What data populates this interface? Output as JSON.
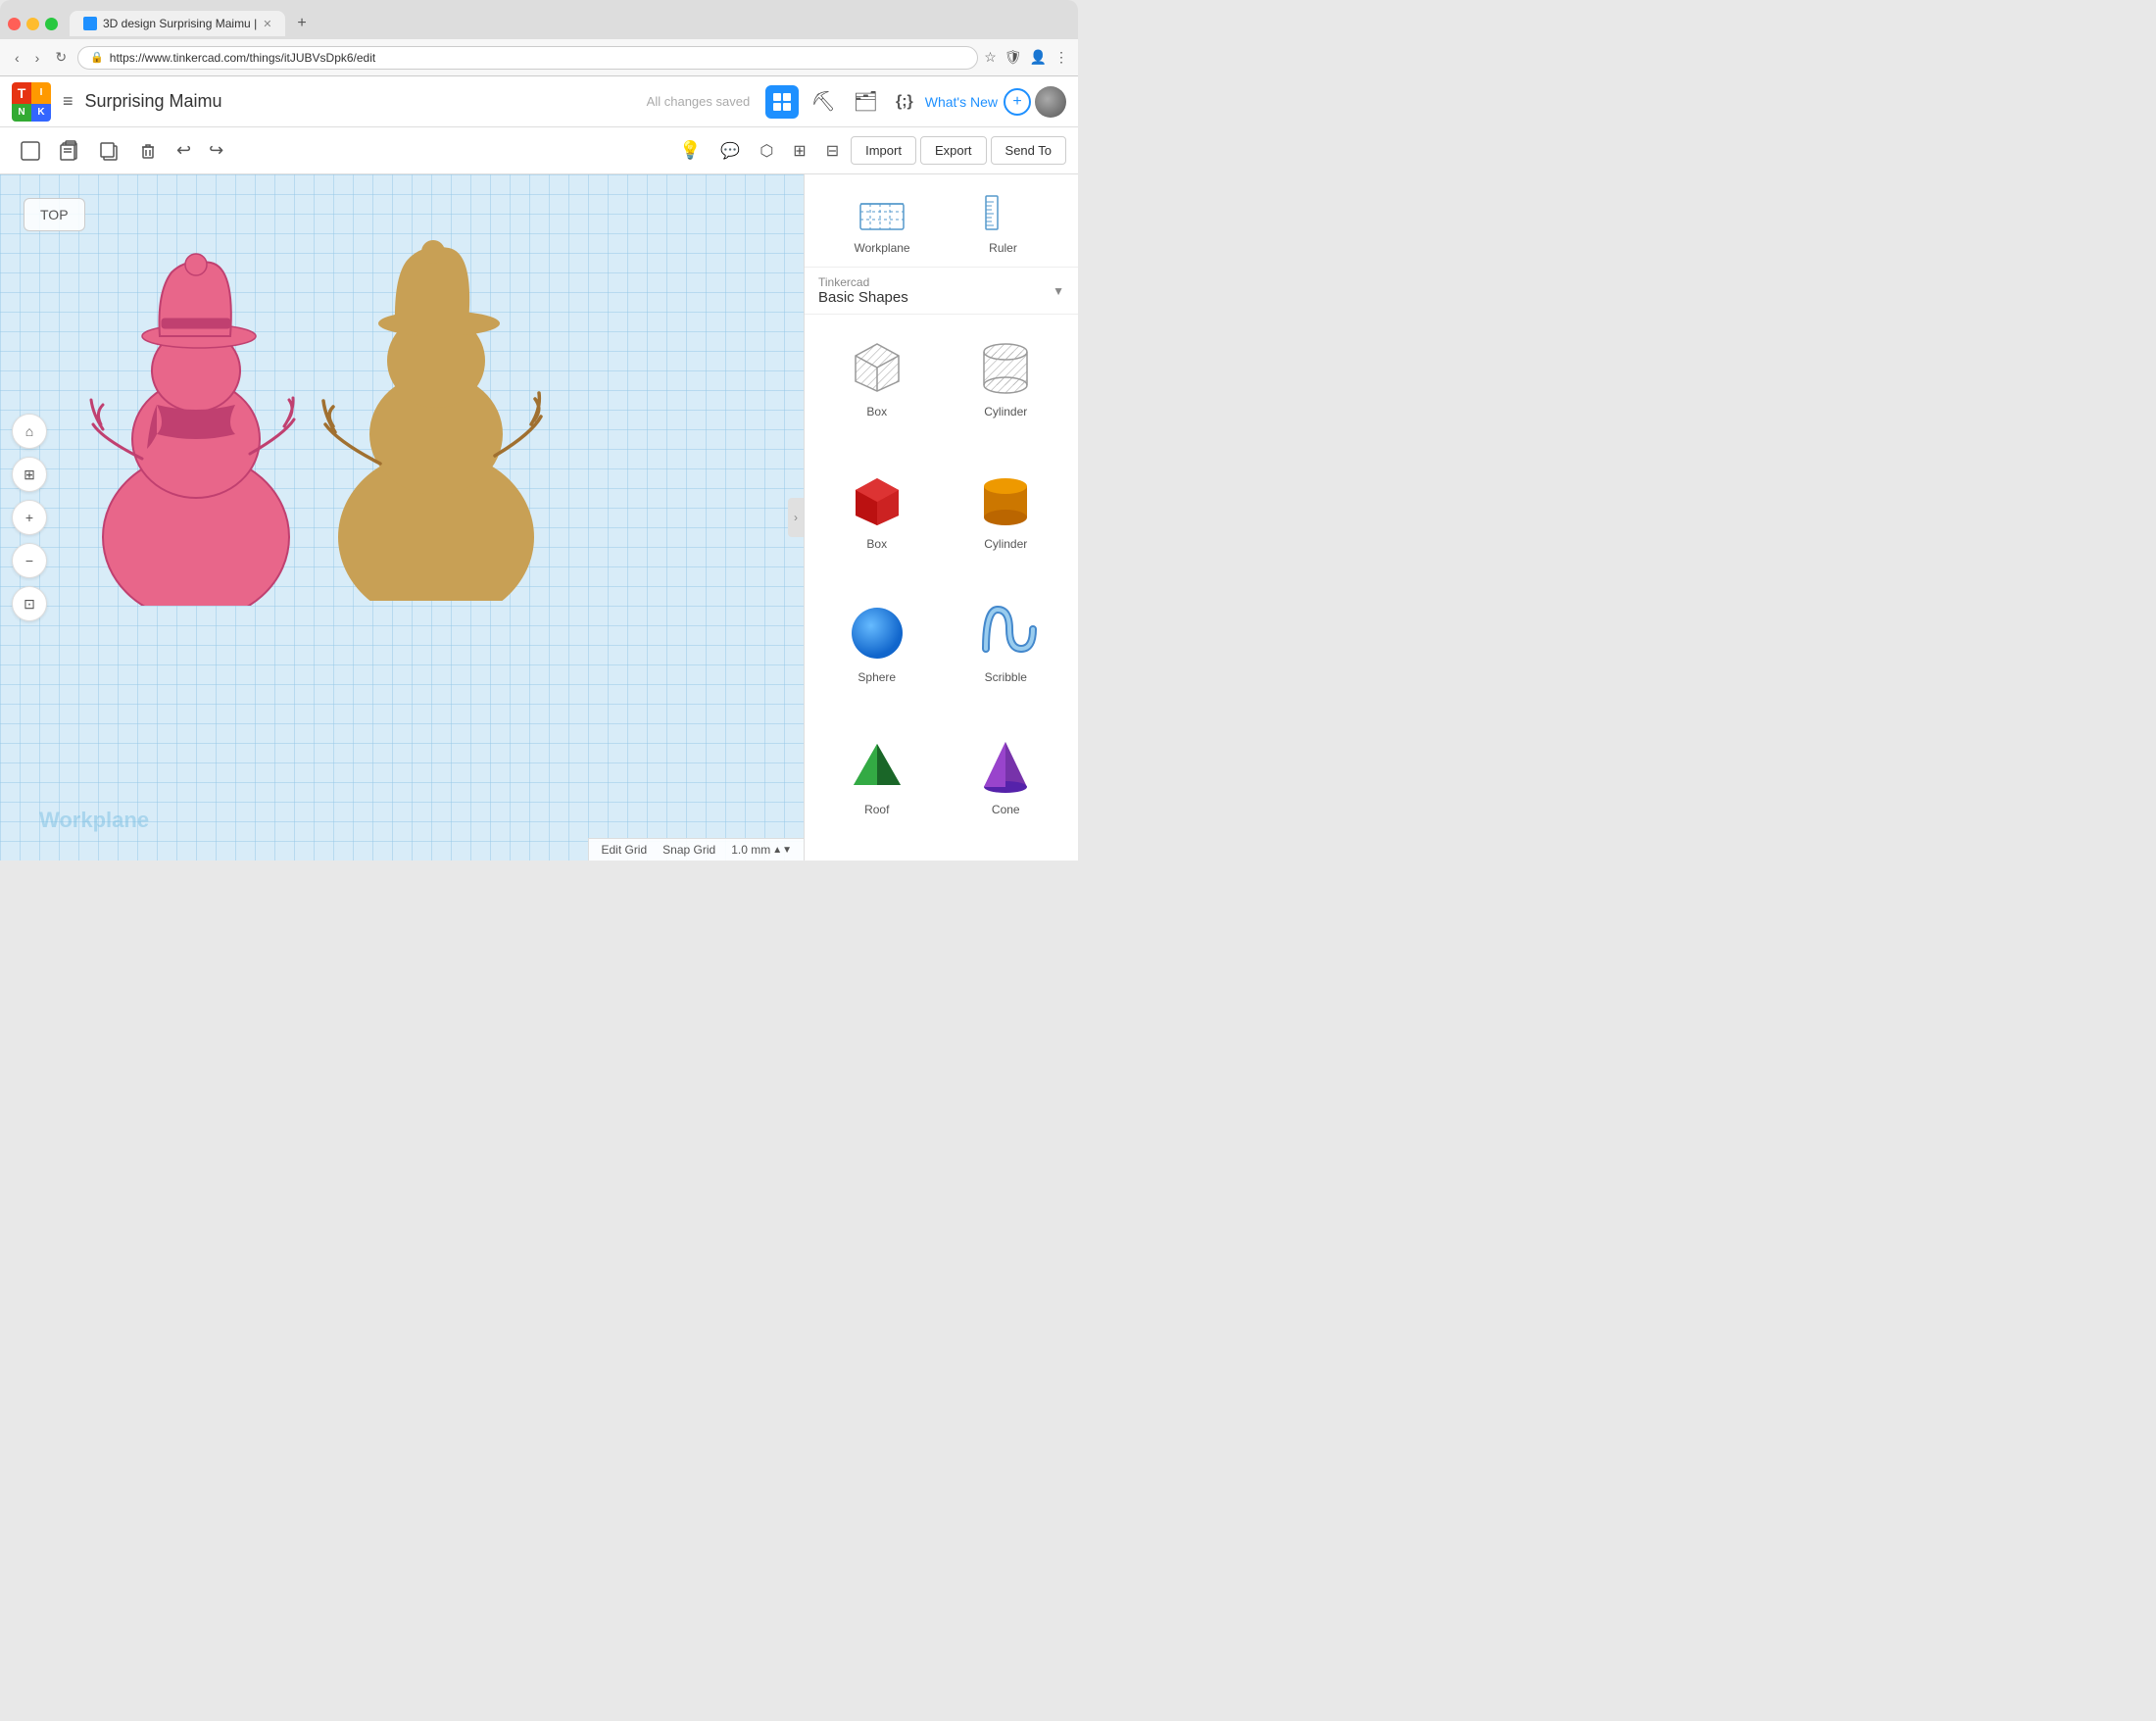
{
  "browser": {
    "tab_title": "3D design Surprising Maimu |",
    "url": "https://www.tinkercad.com/things/itJUBVsDpk6/edit",
    "new_tab_label": "+"
  },
  "app": {
    "logo_letters": [
      "T",
      "I",
      "N",
      "K"
    ],
    "project_name": "Surprising Maimu",
    "save_status": "All changes saved",
    "whats_new": "What's New",
    "nav": {
      "import": "Import",
      "export": "Export",
      "send_to": "Send To"
    },
    "view_label": "TOP",
    "workplane_label": "Workplane",
    "canvas_footer": {
      "edit_grid": "Edit Grid",
      "snap_grid": "Snap Grid",
      "snap_value": "1.0 mm"
    },
    "panel": {
      "workplane": "Workplane",
      "ruler": "Ruler",
      "category_source": "Tinkercad",
      "category_name": "Basic Shapes",
      "shapes": [
        {
          "label": "Box",
          "type": "box-wire"
        },
        {
          "label": "Cylinder",
          "type": "cylinder-wire"
        },
        {
          "label": "Box",
          "type": "box-red"
        },
        {
          "label": "Cylinder",
          "type": "cylinder-orange"
        },
        {
          "label": "Sphere",
          "type": "sphere-blue"
        },
        {
          "label": "Scribble",
          "type": "scribble-blue"
        },
        {
          "label": "Roof",
          "type": "roof-green"
        },
        {
          "label": "Cone",
          "type": "cone-purple"
        }
      ]
    }
  }
}
